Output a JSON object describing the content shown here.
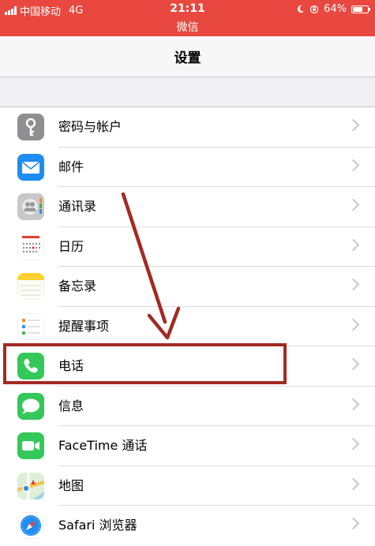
{
  "status_bar": {
    "carrier": "中国移动",
    "network": "4G",
    "time": "21:11",
    "app_name": "微信",
    "battery": "64%",
    "battery_level": 0.64
  },
  "nav": {
    "title": "设置"
  },
  "items": [
    {
      "label": "密码与帐户",
      "icon": "key-icon",
      "color": "#8e8e93"
    },
    {
      "label": "邮件",
      "icon": "mail-icon",
      "color": "#1e8cf2"
    },
    {
      "label": "通讯录",
      "icon": "contacts-icon",
      "color": "#b8b8b8"
    },
    {
      "label": "日历",
      "icon": "calendar-icon",
      "color": "#ffffff"
    },
    {
      "label": "备忘录",
      "icon": "notes-icon",
      "color": "#ffd233"
    },
    {
      "label": "提醒事项",
      "icon": "reminders-icon",
      "color": "#ffffff"
    },
    {
      "label": "电话",
      "icon": "phone-icon",
      "color": "#34c759"
    },
    {
      "label": "信息",
      "icon": "messages-icon",
      "color": "#34c759"
    },
    {
      "label": "FaceTime 通话",
      "icon": "facetime-icon",
      "color": "#34c759"
    },
    {
      "label": "地图",
      "icon": "maps-icon",
      "color": "#dfeed6"
    },
    {
      "label": "Safari 浏览器",
      "icon": "safari-icon",
      "color": "#ffffff"
    }
  ],
  "annotation": {
    "color": "#a32a22",
    "highlighted_item": "电话"
  }
}
